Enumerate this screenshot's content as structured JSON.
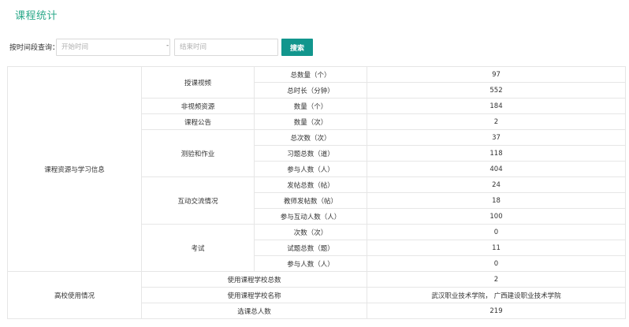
{
  "page": {
    "title": "课程统计"
  },
  "search": {
    "label": "按时间段查询：",
    "start_placeholder": "开始时间",
    "end_placeholder": "结束时间",
    "separator": "-",
    "button_label": "搜索"
  },
  "colors": {
    "accent": "#2aa889",
    "button": "#12968d",
    "border": "#e6e6e6"
  },
  "table": {
    "section_resources": "课程资源与学习信息",
    "section_school": "高校使用情况",
    "video": {
      "category": "授课视频",
      "total_label": "总数量（个）",
      "total_value": "97",
      "duration_label": "总时长（分钟）",
      "duration_value": "552"
    },
    "nonvideo": {
      "category": "非视频资源",
      "label": "数量（个）",
      "value": "184"
    },
    "notice": {
      "category": "课程公告",
      "label": "数量（次）",
      "value": "2"
    },
    "homework": {
      "category": "测验和作业",
      "times_label": "总次数（次）",
      "times_value": "37",
      "questions_label": "习题总数（道）",
      "questions_value": "118",
      "people_label": "参与人数（人）",
      "people_value": "404"
    },
    "discussion": {
      "category": "互动交流情况",
      "posts_label": "发帖总数（帖）",
      "posts_value": "24",
      "teacher_label": "教师发帖数（帖）",
      "teacher_value": "18",
      "people_label": "参与互动人数（人）",
      "people_value": "100"
    },
    "exam": {
      "category": "考试",
      "times_label": "次数（次）",
      "times_value": "0",
      "questions_label": "试题总数（题）",
      "questions_value": "11",
      "people_label": "参与人数（人）",
      "people_value": "0"
    },
    "school": {
      "count_label": "使用课程学校总数",
      "count_value": "2",
      "names_label": "使用课程学校名称",
      "names_value": "武汉职业技术学院， 广西建设职业技术学院",
      "students_label": "选课总人数",
      "students_value": "219"
    }
  }
}
